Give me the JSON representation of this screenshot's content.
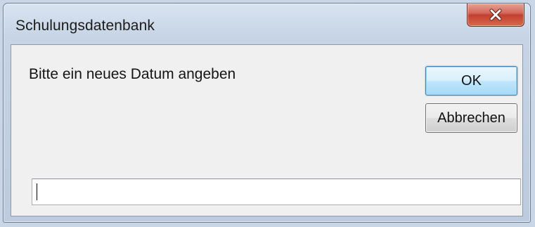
{
  "window": {
    "title": "Schulungsdatenbank"
  },
  "dialog": {
    "prompt": "Bitte ein neues Datum angeben",
    "ok_label": "OK",
    "cancel_label": "Abbrechen",
    "input_value": ""
  },
  "icons": {
    "close": "close-icon"
  },
  "colors": {
    "close_button": "#c94734",
    "ok_border": "#3c7fb1",
    "client_background": "#f0f0f0"
  }
}
